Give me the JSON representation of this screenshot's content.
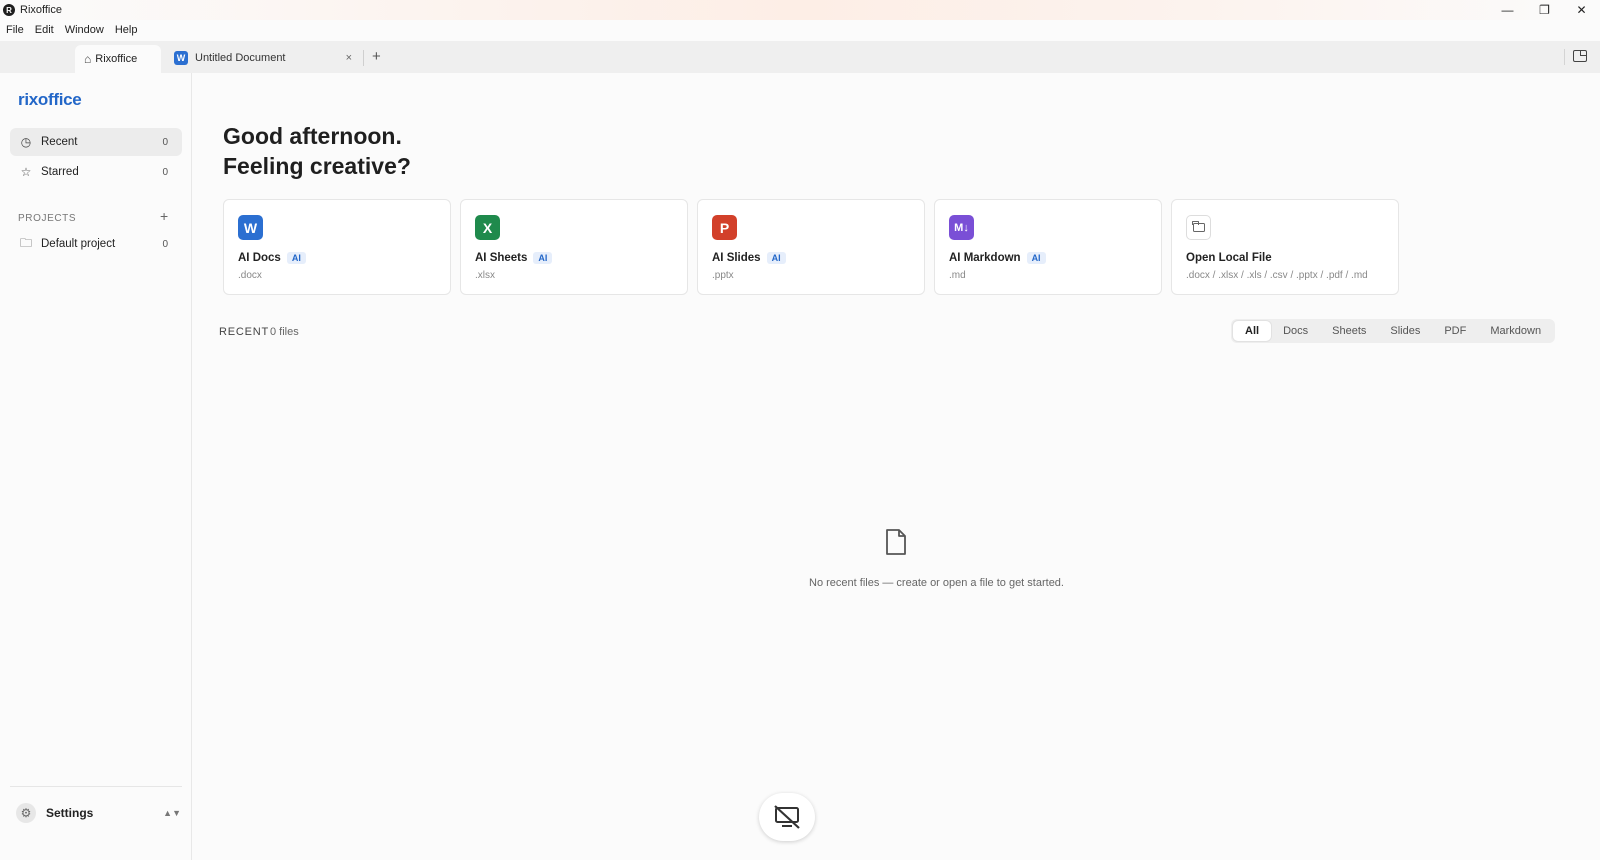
{
  "window": {
    "title": "Rixoffice",
    "logo_letter": "R"
  },
  "menu": [
    "File",
    "Edit",
    "Window",
    "Help"
  ],
  "tabs": {
    "home_label": "Rixoffice",
    "doc_label": "Untitled Document",
    "doc_badge": "W",
    "close_glyph": "×",
    "add_glyph": "+"
  },
  "sidebar": {
    "brand": "rixoffice",
    "nav": [
      {
        "label": "Recent",
        "count": "0",
        "icon": "clock-icon"
      },
      {
        "label": "Starred",
        "count": "0",
        "icon": "star-icon"
      }
    ],
    "projects_label": "PROJECTS",
    "projects": [
      {
        "label": "Default project",
        "count": "0",
        "icon": "folder-icon"
      }
    ],
    "settings_label": "Settings"
  },
  "main": {
    "greeting_line1": "Good afternoon.",
    "greeting_line2": "Feeling creative?",
    "cards": [
      {
        "name": "AI Docs",
        "badge": "AI",
        "ext": ".docx",
        "letter": "W",
        "color": "#2b6fd1"
      },
      {
        "name": "AI Sheets",
        "badge": "AI",
        "ext": ".xlsx",
        "letter": "X",
        "color": "#1f8a4c"
      },
      {
        "name": "AI Slides",
        "badge": "AI",
        "ext": ".pptx",
        "letter": "P",
        "color": "#d2402a"
      },
      {
        "name": "AI Markdown",
        "badge": "AI",
        "ext": ".md",
        "letter": "M↓",
        "color": "#7a4fd6"
      },
      {
        "name": "Open Local File",
        "ext": ".docx / .xlsx / .xls / .csv / .pptx / .pdf / .md"
      }
    ],
    "recent_label": "RECENT",
    "recent_count": "0 files",
    "filters": [
      "All",
      "Docs",
      "Sheets",
      "Slides",
      "PDF",
      "Markdown"
    ],
    "active_filter": "All",
    "empty_text": "No recent files — create or open a file to get started."
  },
  "colors": {
    "accent": "#2367c8",
    "ai_badge_bg": "#e6eefb"
  }
}
